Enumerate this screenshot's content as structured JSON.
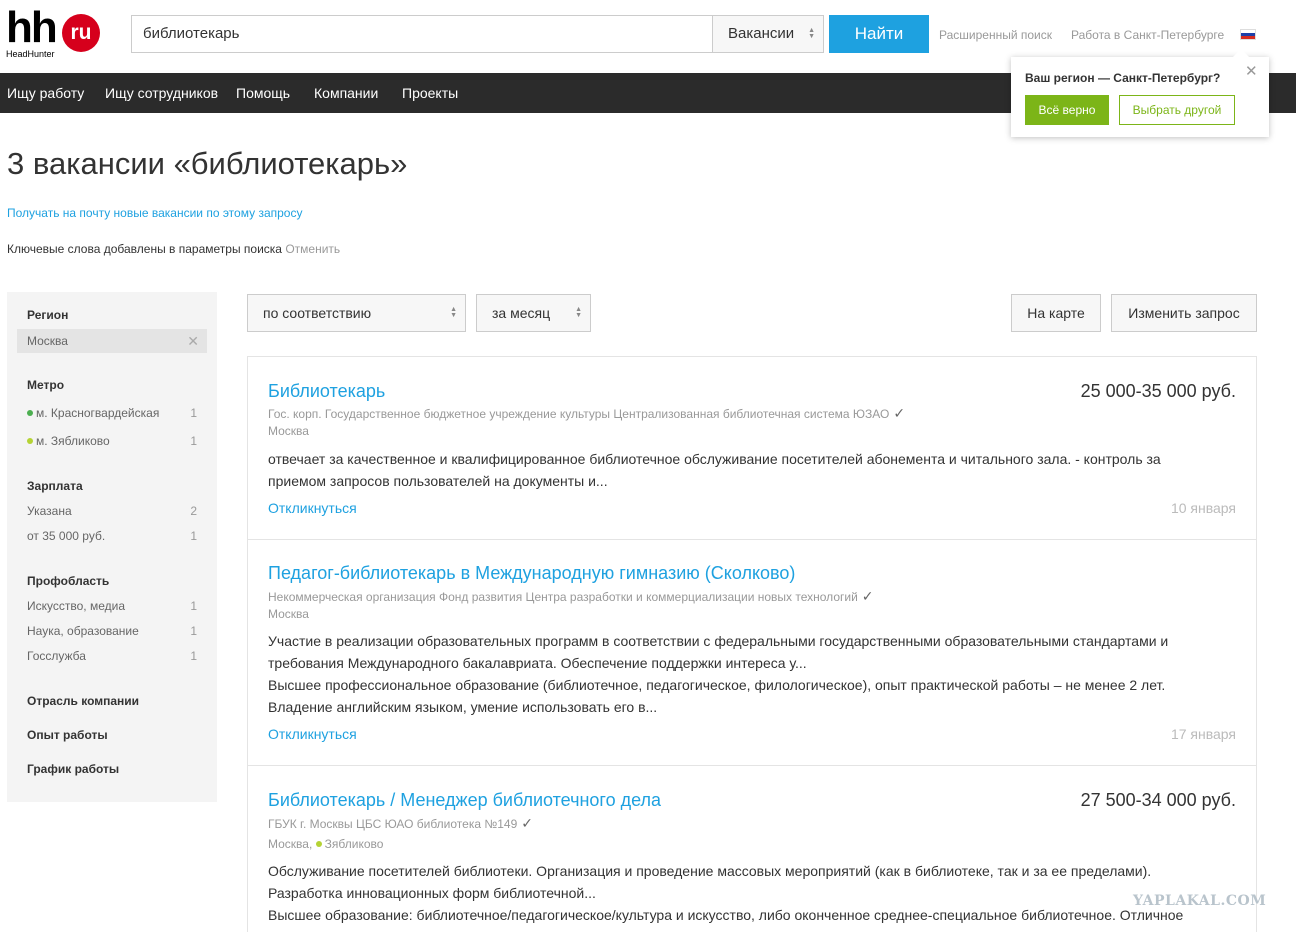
{
  "logo": {
    "main": "hh",
    "badge": "ru",
    "sub": "HeadHunter"
  },
  "search": {
    "query": "библиотекарь",
    "type_selected": "Вакансии",
    "submit_label": "Найти",
    "advanced_label": "Расширенный поиск",
    "city_label": "Работа в Санкт-Петербурге"
  },
  "nav": {
    "items": [
      {
        "label": "Ищу работу"
      },
      {
        "label": "Ищу сотрудников"
      },
      {
        "label": "Помощь"
      },
      {
        "label": "Компании"
      },
      {
        "label": "Проекты"
      }
    ]
  },
  "region_popup": {
    "question": "Ваш регион — Санкт-Петербург?",
    "confirm_label": "Всё верно",
    "other_label": "Выбрать другой",
    "close_glyph": "✕"
  },
  "page": {
    "title": "3 вакансии «библиотекарь»",
    "subscribe_link": "Получать на почту новые вакансии по этому запросу",
    "keywords_note": "Ключевые слова добавлены в параметры поиска",
    "keywords_cancel": "Отменить"
  },
  "sidebar": {
    "region": {
      "title": "Регион",
      "value": "Москва",
      "clear_glyph": "✕"
    },
    "metro": {
      "title": "Метро",
      "items": [
        {
          "label": "м. Красногвардейская",
          "count": "1",
          "color": "#4caf50"
        },
        {
          "label": "м. Зябликово",
          "count": "1",
          "color": "#b5d334"
        }
      ]
    },
    "salary": {
      "title": "Зарплата",
      "items": [
        {
          "label": "Указана",
          "count": "2"
        },
        {
          "label": "от 35 000 руб.",
          "count": "1"
        }
      ]
    },
    "profarea": {
      "title": "Профобласть",
      "items": [
        {
          "label": "Искусство, медиа",
          "count": "1"
        },
        {
          "label": "Наука, образование",
          "count": "1"
        },
        {
          "label": "Госслужба",
          "count": "1"
        }
      ]
    },
    "industry_title": "Отрасль компании",
    "experience_title": "Опыт работы",
    "schedule_title": "График работы"
  },
  "controls": {
    "sort_selected": "по соответствию",
    "period_selected": "за месяц",
    "map_label": "На карте",
    "change_query_label": "Изменить запрос"
  },
  "vacancies": [
    {
      "title": "Библиотекарь",
      "salary": "25 000-35 000 руб.",
      "company": "Гос. корп. Государственное бюджетное учреждение культуры Централизованная библиотечная система ЮЗАО",
      "location": "Москва",
      "desc_lines": [
        "отвечает за качественное и квалифицированное библиотечное обслуживание посетителей абонемента и читального зала. - контроль за",
        "приемом запросов пользователей на документы и..."
      ],
      "apply_label": "Откликнуться",
      "date": "10 января"
    },
    {
      "title": "Педагог-библиотекарь в Международную гимназию (Сколково)",
      "salary": "",
      "company": "Некоммерческая организация Фонд развития Центра разработки и коммерциализации новых технологий",
      "location": "Москва",
      "desc_lines": [
        "Участие в реализации образовательных программ в соответствии с федеральными государственными образовательными стандартами и",
        "требования Международного бакалавриата. Обеспечение поддержки интереса у...",
        "Высшее профессиональное образование (библиотечное, педагогическое, филологическое), опыт практической работы – не менее 2 лет.",
        "Владение английским языком, умение использовать его в..."
      ],
      "apply_label": "Откликнуться",
      "date": "17 января"
    },
    {
      "title": "Библиотекарь / Менеджер библиотечного дела",
      "salary": "27 500-34 000 руб.",
      "company": "ГБУК г. Москвы ЦБС ЮАО библиотека №149",
      "location": "Москва,",
      "metro": "Зябликово",
      "metro_color": "#b5d334",
      "desc_lines": [
        "Обслуживание посетителей библиотеки. Организация и проведение массовых мероприятий (как в библиотеке, так и за ее пределами).",
        "Разработка инновационных форм библиотечной...",
        "Высшее образование: библиотечное/педагогическое/культура и искусство, либо оконченное среднее-специальное библиотечное. Отличное"
      ]
    }
  ],
  "watermark": "YAPLAKAL.COM",
  "colors": {
    "accent": "#1ea1e0",
    "brand_red": "#d6001c",
    "green": "#7cb518",
    "nav_bg": "#2b2b2b"
  }
}
